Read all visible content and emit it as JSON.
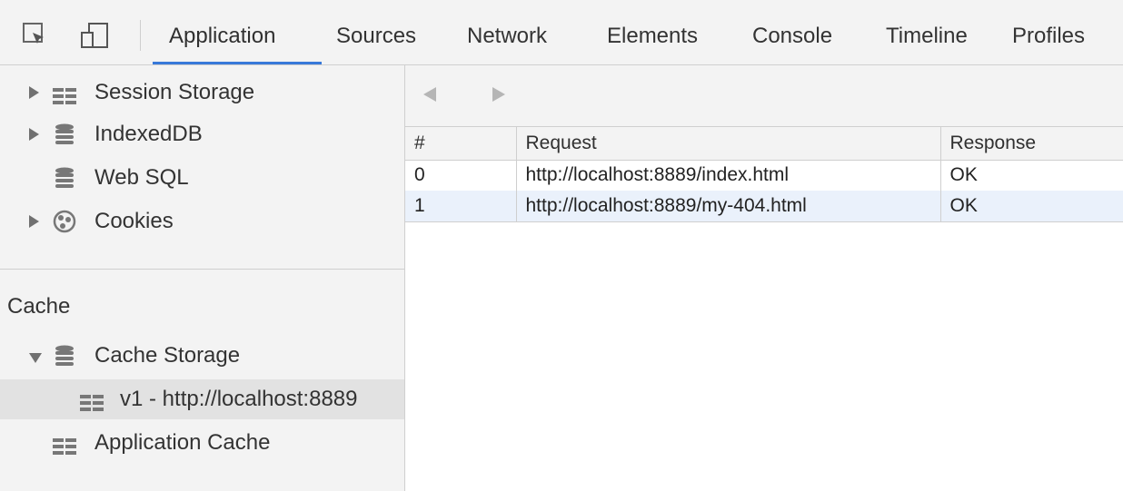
{
  "toolbar": {
    "tabs": [
      {
        "label": "Application",
        "active": true
      },
      {
        "label": "Sources"
      },
      {
        "label": "Network"
      },
      {
        "label": "Elements"
      },
      {
        "label": "Console"
      },
      {
        "label": "Timeline"
      },
      {
        "label": "Profiles"
      }
    ],
    "accent": "#3879d9"
  },
  "sidebar": {
    "items": [
      {
        "label": "Session Storage",
        "icon": "grid-icon",
        "expander": "collapsed"
      },
      {
        "label": "IndexedDB",
        "icon": "database-icon",
        "expander": "collapsed"
      },
      {
        "label": "Web SQL",
        "icon": "database-icon"
      },
      {
        "label": "Cookies",
        "icon": "cookie-icon",
        "expander": "collapsed"
      }
    ],
    "cache_section": {
      "title": "Cache",
      "items": [
        {
          "label": "Cache Storage",
          "icon": "database-icon",
          "expander": "expanded"
        },
        {
          "label": "v1 - http://localhost:8889",
          "icon": "grid-icon",
          "selected": true
        },
        {
          "label": "Application Cache",
          "icon": "grid-icon"
        }
      ]
    }
  },
  "table": {
    "headers": [
      "#",
      "Request",
      "Response"
    ],
    "rows": [
      {
        "index": "0",
        "request": "http://localhost:8889/index.html",
        "response": "OK"
      },
      {
        "index": "1",
        "request": "http://localhost:8889/my-404.html",
        "response": "OK"
      }
    ]
  }
}
